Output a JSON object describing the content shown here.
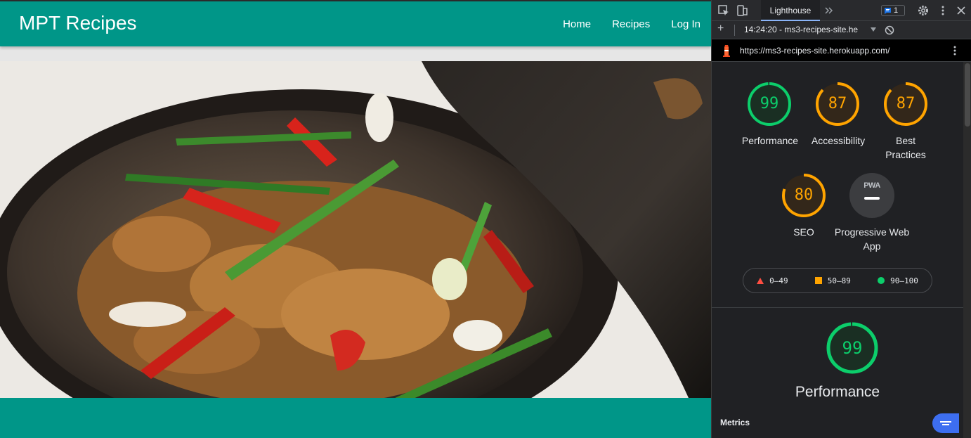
{
  "site": {
    "brand": "MPT Recipes",
    "nav": [
      "Home",
      "Recipes",
      "Log In"
    ],
    "colors": {
      "primary": "#009688"
    }
  },
  "devtools": {
    "active_tab": "Lighthouse",
    "more_tabs_icon": "chevron-double-right-icon",
    "issues_count": "1",
    "report_select": "14:24:20 - ms3-recipes-site.he",
    "url": "https://ms3-recipes-site.herokuapp.com/",
    "scores": [
      {
        "value": 99,
        "label": "Performance",
        "color": "#0cce6b"
      },
      {
        "value": 87,
        "label": "Accessibility",
        "color": "#ffa400"
      },
      {
        "value": 87,
        "label": "Best Practices",
        "color": "#ffa400"
      },
      {
        "value": 80,
        "label": "SEO",
        "color": "#ffa400"
      }
    ],
    "pwa": {
      "badge": "PWA",
      "label": "Progressive Web App"
    },
    "legend": [
      "0–49",
      "50–89",
      "90–100"
    ],
    "legend_colors": [
      "#ff4e42",
      "#ffa400",
      "#0cce6b"
    ],
    "big_score": {
      "value": 99,
      "label": "Performance"
    },
    "metrics_heading": "Metrics"
  }
}
